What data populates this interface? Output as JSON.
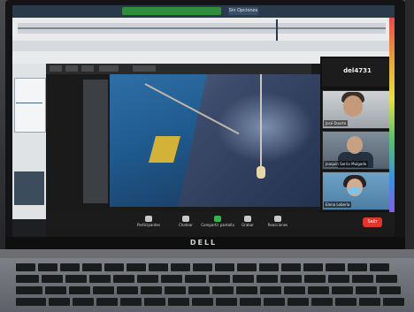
{
  "photo": {
    "brand": "DELL"
  },
  "app": {
    "top_right_label": "Sin Opciones",
    "participants_header_name": "del4731",
    "participants": [
      {
        "label": "José Duarte"
      },
      {
        "label": "Joaquín Sarria Mulgado"
      },
      {
        "label": "Elena Lobería"
      }
    ],
    "controls": [
      {
        "label": "Participantes",
        "icon": "participants-icon"
      },
      {
        "label": "Chatear",
        "icon": "chat-icon"
      },
      {
        "label": "Compartir pantalla",
        "icon": "share-screen-icon"
      },
      {
        "label": "Grabar",
        "icon": "record-icon"
      },
      {
        "label": "Reacciones",
        "icon": "reactions-icon"
      }
    ],
    "end_label": "Salir"
  },
  "colors": {
    "share_green": "#2f8d3b",
    "end_red": "#e0362b",
    "footage_blue": "#1f5a8e",
    "deck_yellow": "#d3b23a"
  }
}
